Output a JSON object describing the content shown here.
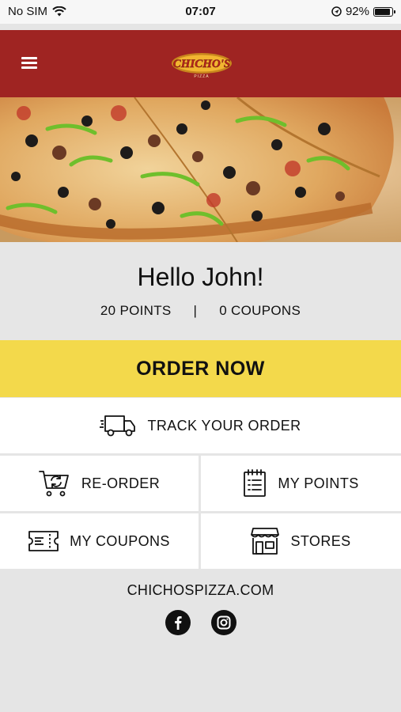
{
  "status_bar": {
    "carrier": "No SIM",
    "time": "07:07",
    "battery": "92%",
    "battery_level": 0.92,
    "icons": [
      "wifi-icon",
      "location-icon",
      "battery-icon"
    ]
  },
  "header": {
    "logo_text": "CHICHO'S",
    "logo_tagline": "PIZZA",
    "menu_icon": "hamburger-menu-icon",
    "brand_color": "#9f2422"
  },
  "hero": {
    "description": "pizza-photo"
  },
  "greeting": {
    "title": "Hello John!",
    "points": "20 POINTS",
    "separator": "|",
    "coupons": "0 COUPONS"
  },
  "actions": {
    "order_now": "ORDER NOW",
    "order_now_color": "#f3d94b",
    "track_order": "TRACK YOUR ORDER",
    "reorder": "RE-ORDER",
    "my_points": "MY POINTS",
    "my_coupons": "MY COUPONS",
    "stores": "STORES"
  },
  "footer": {
    "website": "CHICHOSPIZZA.COM",
    "social": [
      "facebook-icon",
      "instagram-icon"
    ]
  }
}
